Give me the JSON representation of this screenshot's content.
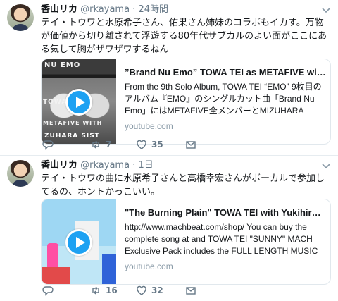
{
  "tweets": [
    {
      "name": "香山リカ",
      "handle": "@rkayama",
      "dot": "·",
      "time": "24時間",
      "text": "テイ・トウワと水原希子さん、佑果さん姉妹のコラボもイカす。万物が価値から切り離されて浮遊する80年代サブカルのよい面がここにある気して胸がザワザワするねん",
      "card": {
        "title": "”Brand Nu Emo” TOWA TEI as METAFIVE with MIZ...",
        "description": "From the 9th Solo Album, TOWA TEI “EMO” 9枚目のアルバム『EMO』のシングルカット曲「Brand Nu Emo」にはMETAFIVE全メンバーとMIZUHARA SISTERSが参加!!! ...",
        "domain": "youtube.com",
        "thumb_text": [
          "NU EMO",
          "TOWA TEI",
          "METAFIVE WITH",
          "ZUHARA SIST"
        ]
      },
      "counts": {
        "replies": "",
        "retweets": "7",
        "likes": "35"
      }
    },
    {
      "name": "香山リカ",
      "handle": "@rkayama",
      "dot": "·",
      "time": "1日",
      "text": "テイ・トウワの曲に水原希子さんと高橋幸宏さんがボーカルで参加してるの、ホントかっこいい。",
      "card": {
        "title": "\"The Burning Plain\" TOWA TEI with Yukihiro Takah...",
        "description": "http://www.machbeat.com/shop/ You can buy the complete song at and TOWA TEI \"SUNNY\" MACH Exclusive Pack includes the FULL LENGTH MUSIC ...",
        "domain": "youtube.com"
      },
      "counts": {
        "replies": "",
        "retweets": "16",
        "likes": "32"
      }
    }
  ],
  "icons": {
    "reply": "reply-icon",
    "retweet": "retweet-icon",
    "like": "heart-icon",
    "dm": "envelope-icon",
    "caret": "chevron-down-icon",
    "play": "play-icon"
  },
  "colors": {
    "accent": "#1da1f2",
    "muted": "#657786",
    "border": "#e6ecf0"
  }
}
